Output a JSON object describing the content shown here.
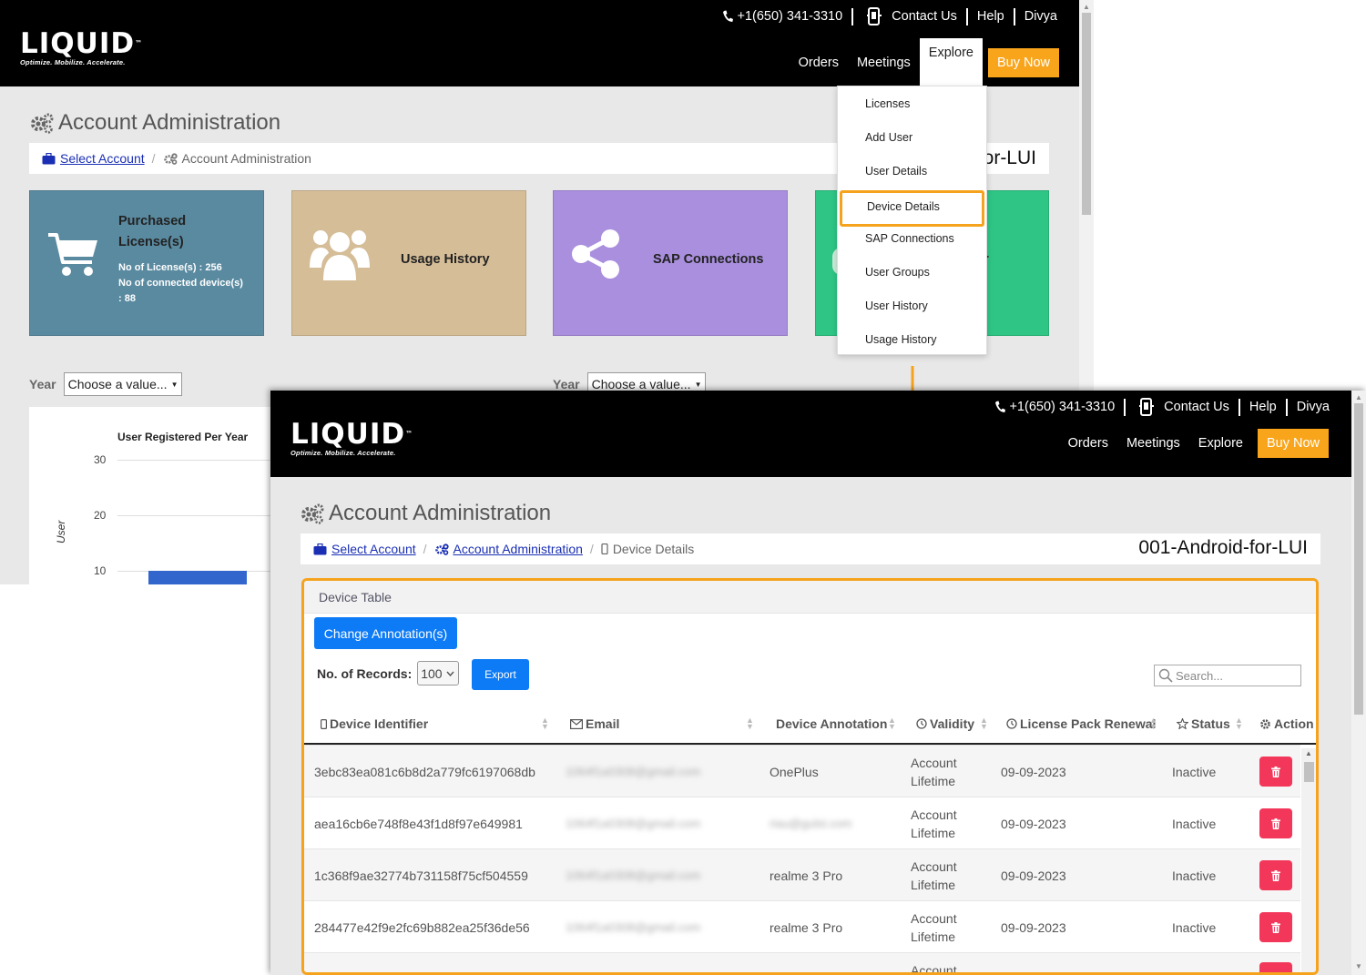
{
  "brand": {
    "name": "LIQUID",
    "tagline": "Optimize. Mobilize. Accelerate."
  },
  "topbar": {
    "phone": "+1(650) 341-3310",
    "contact": "Contact Us",
    "help": "Help",
    "user": "Divya"
  },
  "nav": {
    "orders": "Orders",
    "meetings": "Meetings",
    "explore": "Explore",
    "buy": "Buy Now"
  },
  "page_title": "Account Administration",
  "breadcrumb1": {
    "select_account": "Select Account",
    "current": "Account Administration"
  },
  "breadcrumb2": {
    "select_account": "Select Account",
    "account_admin": "Account Administration",
    "current": "Device Details"
  },
  "account_name": "001-Android-for-LUI",
  "account_name_partial": "or-LUI",
  "cards": {
    "purchased": {
      "title_line1": "Purchased",
      "title_line2": "License(s)",
      "licenses": "No of License(s) : 256",
      "connected_line1": "No of connected device(s)",
      "connected_line2": ": 88"
    },
    "usage": {
      "title": "Usage History"
    },
    "sap": {
      "title": "SAP Connections"
    },
    "user_partial": "er"
  },
  "year_filter": {
    "label": "Year",
    "placeholder": "Choose a value..."
  },
  "chart_data": {
    "type": "bar",
    "title": "User Registered Per Year",
    "ylabel": "User",
    "yticks": [
      "30",
      "20",
      "10"
    ],
    "categories": [
      ""
    ],
    "values": [
      10
    ],
    "ylim": [
      0,
      30
    ]
  },
  "explore_menu": [
    "Licenses",
    "Add User",
    "User Details",
    "Device Details",
    "SAP Connections",
    "User Groups",
    "User History",
    "Usage History"
  ],
  "highlight_item": "Device Details",
  "device_table": {
    "panel_title": "Device Table",
    "change_button": "Change Annotation(s)",
    "records_label": "No. of Records:",
    "records_value": "100",
    "export_button": "Export",
    "search_placeholder": "Search...",
    "columns": {
      "device_identifier": "Device Identifier",
      "email": "Email",
      "annotation": "Device Annotation",
      "validity": "Validity",
      "renewal": "License Pack Renewal",
      "status": "Status",
      "action": "Action"
    },
    "rows": [
      {
        "id": "3ebc83ea081c6b8d2a779fc6197068db",
        "email": "1064f1a0308@gmail.com",
        "annotation": "OnePlus",
        "validity1": "Account",
        "validity2": "Lifetime",
        "renewal": "09-09-2023",
        "status": "Inactive"
      },
      {
        "id": "aea16cb6e748f8e43f1d8f97e649981",
        "email": "1064f1a0308@gmail.com",
        "annotation": "riau@gulst.com",
        "validity1": "Account",
        "validity2": "Lifetime",
        "renewal": "09-09-2023",
        "status": "Inactive"
      },
      {
        "id": "1c368f9ae32774b731158f75cf504559",
        "email": "1064f1a0308@gmail.com",
        "annotation": "realme 3 Pro",
        "validity1": "Account",
        "validity2": "Lifetime",
        "renewal": "09-09-2023",
        "status": "Inactive"
      },
      {
        "id": "284477e42f9e2fc69b882ea25f36de56",
        "email": "1064f1a0308@gmail.com",
        "annotation": "realme 3 Pro",
        "validity1": "Account",
        "validity2": "Lifetime",
        "renewal": "09-09-2023",
        "status": "Inactive"
      },
      {
        "id": "",
        "email": "",
        "annotation": "",
        "validity1": "Account",
        "validity2": "",
        "renewal": "",
        "status": ""
      }
    ]
  },
  "colors": {
    "accent_orange": "#f5a31d",
    "buy_now": "#f8a51c",
    "primary_blue": "#0d7bf5",
    "delete_red": "#f2375a",
    "card_purchased": "#5a8aa0",
    "card_usage": "#d5bd98",
    "card_sap": "#a98fde",
    "card_user": "#2ec585"
  }
}
